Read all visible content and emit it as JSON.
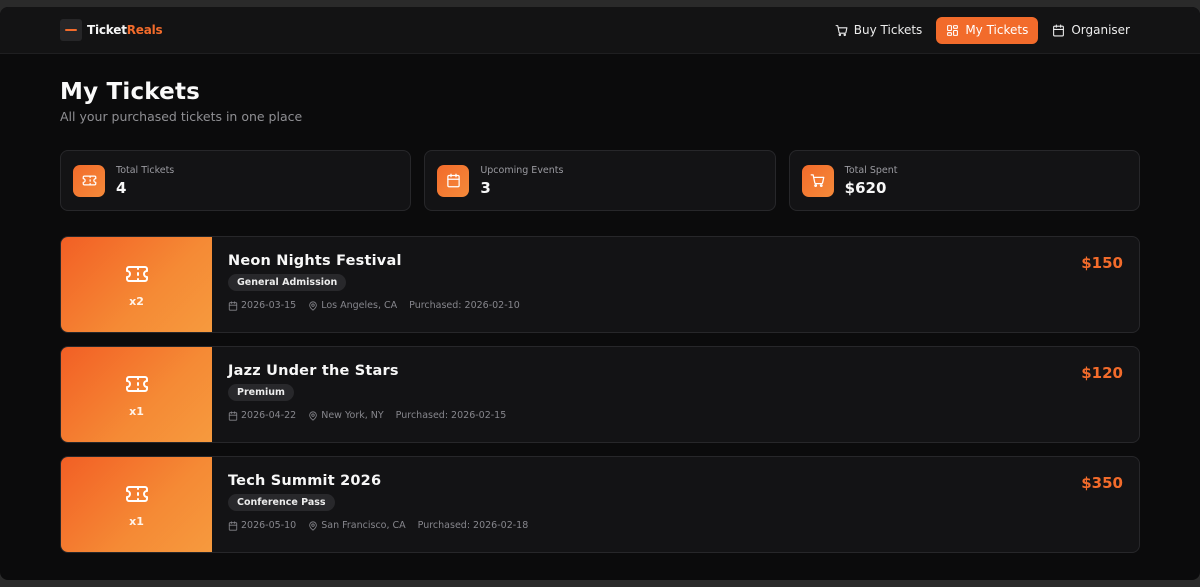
{
  "app": {
    "brand_part1": "Ticket",
    "brand_part2": "Reals"
  },
  "nav": {
    "buy_tickets": "Buy Tickets",
    "my_tickets": "My Tickets",
    "organiser": "Organiser",
    "active": "My Tickets"
  },
  "page": {
    "title": "My Tickets",
    "subtitle": "All your purchased tickets in one place"
  },
  "stats": [
    {
      "label": "Total Tickets",
      "value": "4",
      "icon": "ticket-icon"
    },
    {
      "label": "Upcoming Events",
      "value": "3",
      "icon": "calendar-icon"
    },
    {
      "label": "Total Spent",
      "value": "$620",
      "icon": "cart-icon"
    }
  ],
  "tickets": [
    {
      "name": "Neon Nights Festival",
      "type": "General Admission",
      "qty": "x2",
      "date": "2026-03-15",
      "location": "Los Angeles, CA",
      "purchased": "Purchased: 2026-02-10",
      "price": "$150"
    },
    {
      "name": "Jazz Under the Stars",
      "type": "Premium",
      "qty": "x1",
      "date": "2026-04-22",
      "location": "New York, NY",
      "purchased": "Purchased: 2026-02-15",
      "price": "$120"
    },
    {
      "name": "Tech Summit 2026",
      "type": "Conference Pass",
      "qty": "x1",
      "date": "2026-05-10",
      "location": "San Francisco, CA",
      "purchased": "Purchased: 2026-02-18",
      "price": "$350"
    }
  ],
  "colors": {
    "accent": "#f26b2b",
    "background": "#0b0b0c",
    "card": "#131315"
  }
}
